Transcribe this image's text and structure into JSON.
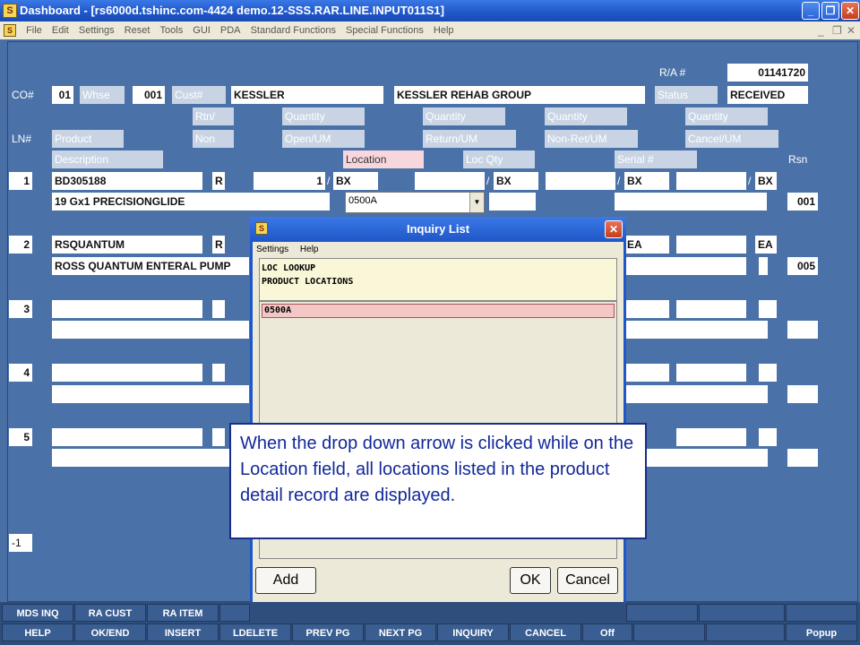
{
  "window": {
    "title": "Dashboard - [rs6000d.tshinc.com-4424 demo.12-SSS.RAR.LINE.INPUT011S1]",
    "app_icon": "app-logo-icon"
  },
  "menu": [
    "File",
    "Edit",
    "Settings",
    "Reset",
    "Tools",
    "GUI",
    "PDA",
    "Standard Functions",
    "Special Functions",
    "Help"
  ],
  "header": {
    "ra_label": "R/A #",
    "ra_value": "01141720",
    "co_label": "CO#",
    "co_value": "01",
    "whse_label": "Whse",
    "whse_value": "001",
    "cust_label": "Cust#",
    "cust_value": "KESSLER",
    "cust_name": "KESSLER REHAB GROUP",
    "status_label": "Status",
    "status_value": "RECEIVED"
  },
  "columns": {
    "rtn": "Rtn/",
    "non": "Non",
    "quantity": "Quantity",
    "open_um": "Open/UM",
    "return_um": "Return/UM",
    "nonret_um": "Non-Ret/UM",
    "cancel_um": "Cancel/UM",
    "ln": "LN#",
    "product": "Product",
    "description": "Description",
    "location": "Location",
    "loc_qty": "Loc Qty",
    "serial": "Serial #",
    "rsn": "Rsn"
  },
  "lines": [
    {
      "ln": "1",
      "product": "BD305188",
      "r": "R",
      "open_qty": "1",
      "um": "BX",
      "sep": "/",
      "description": "19 Gx1 PRECISIONGLIDE",
      "location": "0500A",
      "rsn": "001"
    },
    {
      "ln": "2",
      "product": "RSQUANTUM",
      "r": "R",
      "um": "EA",
      "description": "ROSS QUANTUM ENTERAL PUMP",
      "rsn": "005"
    },
    {
      "ln": "3"
    },
    {
      "ln": "4"
    },
    {
      "ln": "5"
    }
  ],
  "page_indicator": "-1",
  "dialog": {
    "title": "Inquiry List",
    "menu": [
      "Settings",
      "Help"
    ],
    "header_line1": "LOC LOOKUP",
    "header_line2": "PRODUCT LOCATIONS",
    "rows": [
      "0500A"
    ],
    "add": "Add",
    "ok": "OK",
    "cancel": "Cancel"
  },
  "callout": "When the drop down arrow is clicked while on the Location field, all locations listed in the product detail record are displayed.",
  "fkeys_row1": [
    "MDS INQ",
    "RA CUST",
    "RA ITEM"
  ],
  "fkeys_row2": [
    "HELP",
    "OK/END",
    "INSERT",
    "LDELETE",
    "PREV PG",
    "NEXT PG",
    "INQUIRY",
    "CANCEL",
    "Off",
    "Popup"
  ]
}
